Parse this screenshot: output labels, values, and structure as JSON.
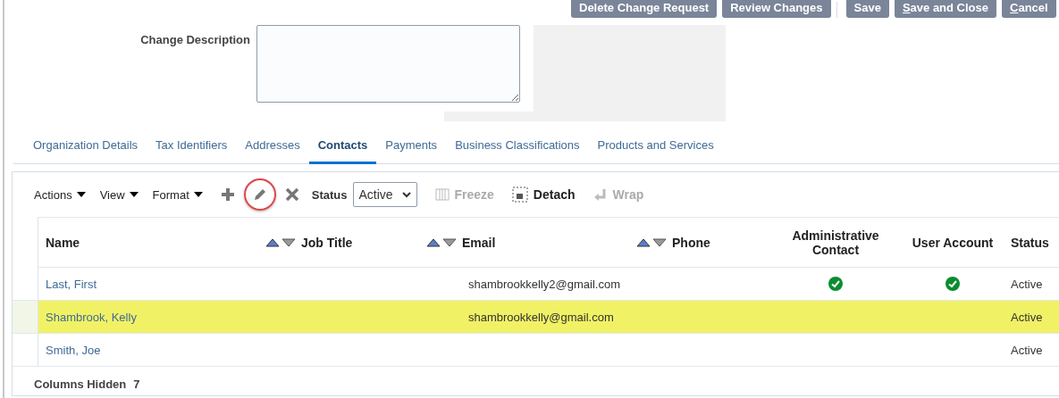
{
  "header_button_groups": [
    {
      "buttons": [
        {
          "label": "Delete Change Request",
          "mnemonic": false
        },
        {
          "label": "Review Changes",
          "mnemonic": false
        }
      ]
    },
    {
      "buttons": [
        {
          "label": "Save",
          "mnemonic": false
        },
        {
          "label": "Save and Close",
          "mnemonic": true
        },
        {
          "label": "Cancel",
          "mnemonic": true
        }
      ]
    }
  ],
  "change_description": {
    "label": "Change Description"
  },
  "tabs": [
    {
      "label": "Organization Details",
      "selected": false
    },
    {
      "label": "Tax Identifiers",
      "selected": false
    },
    {
      "label": "Addresses",
      "selected": false
    },
    {
      "label": "Contacts",
      "selected": true
    },
    {
      "label": "Payments",
      "selected": false
    },
    {
      "label": "Business Classifications",
      "selected": false
    },
    {
      "label": "Products and Services",
      "selected": false
    }
  ],
  "toolbar": {
    "menus": [
      "Actions",
      "View",
      "Format"
    ],
    "actions": [
      {
        "kind": "add",
        "disabled": false,
        "circled": false
      },
      {
        "kind": "edit",
        "disabled": false,
        "circled": true
      },
      {
        "kind": "delete",
        "disabled": false,
        "circled": false
      }
    ],
    "status_filter": {
      "label": "Status",
      "value": "Active"
    },
    "buttons": [
      {
        "kind": "freeze",
        "label": "Freeze",
        "disabled": true
      },
      {
        "kind": "detach",
        "label": "Detach",
        "disabled": false
      },
      {
        "kind": "wrap",
        "label": "Wrap",
        "disabled": true
      }
    ]
  },
  "table": {
    "columns": [
      {
        "label": "Name",
        "sortable": false
      },
      {
        "label": "Job Title",
        "sortable": true
      },
      {
        "label": "Email",
        "sortable": true
      },
      {
        "label": "Phone",
        "sortable": true
      },
      {
        "label": "Administrative Contact",
        "sortable": false
      },
      {
        "label": "User Account",
        "sortable": false
      },
      {
        "label": "Status",
        "sortable": false
      }
    ],
    "rows": [
      {
        "name": "Last, First",
        "email": "shambrookkelly2@gmail.com",
        "administrative_contact": true,
        "user_account": true,
        "status": "Active",
        "selected": false,
        "highlighted": false
      },
      {
        "name": "Shambrook, Kelly",
        "email": "shambrookkelly@gmail.com",
        "administrative_contact": false,
        "user_account": false,
        "status": "Active",
        "selected": true,
        "highlighted": true
      },
      {
        "name": "Smith, Joe",
        "administrative_contact": false,
        "user_account": false,
        "status": "Active",
        "selected": false,
        "highlighted": false
      }
    ],
    "columns_hidden": {
      "label": "Columns Hidden",
      "count": "7"
    }
  }
}
